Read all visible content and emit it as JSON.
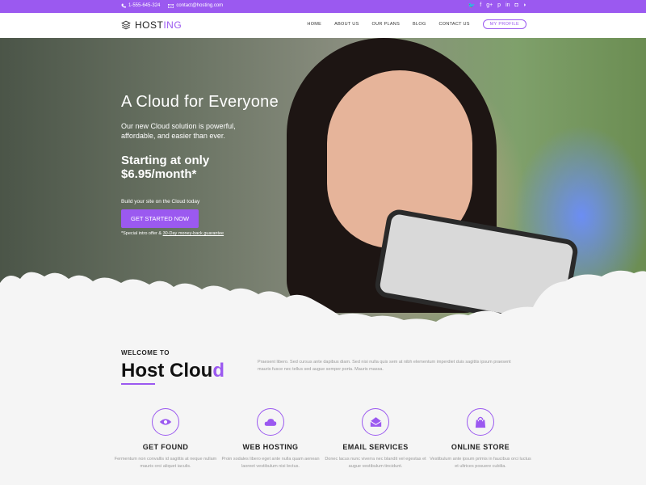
{
  "topbar": {
    "phone": "1-555-645-324",
    "email": "contact@hosting.com",
    "social_icons": [
      "twitter-icon",
      "facebook-icon",
      "google-plus-icon",
      "pinterest-icon",
      "linkedin-icon",
      "instagram-icon",
      "rss-icon"
    ]
  },
  "logo": {
    "text_main": "HOST",
    "text_accent": "ING"
  },
  "nav": {
    "items": [
      "HOME",
      "ABOUT US",
      "OUR PLANS",
      "BLOG",
      "CONTACT US"
    ],
    "profile": "MY PROFILE"
  },
  "hero": {
    "title": "A Cloud for Everyone",
    "subtitle": "Our new Cloud solution is powerful, affordable, and easier than ever.",
    "price_line1": "Starting at only",
    "price_line2": "$6.95/month*",
    "build_text": "Build your site on the Cloud today",
    "cta": "GET STARTED NOW",
    "note_prefix": "*Special intro offer & ",
    "note_link": "30-Day money-back guarantee"
  },
  "welcome": {
    "kicker": "WELCOME TO",
    "title_main": "Host Clou",
    "title_accent": "d",
    "text": "Praesent libero. Sed cursus ante dapibus diam. Sed nisi nulla quis sem at nibh elementum imperdiet duis sagittis ipsum praesent mauris fusce nec tellus sed augue semper porta. Mauris massa."
  },
  "features": [
    {
      "icon": "eye-icon",
      "title": "GET FOUND",
      "desc": "Fermentum non convallis id sagittis at neque nullam mauris orci aliquet iaculis."
    },
    {
      "icon": "cloud-icon",
      "title": "WEB HOSTING",
      "desc": "Proin sodales libero eget ante nulla quam aenean laoreet vestibulum nisi lectus."
    },
    {
      "icon": "envelope-icon",
      "title": "EMAIL SERVICES",
      "desc": "Donec lacus nunc viverra nec blandit vel egestas et augue vestibulum tincidunt."
    },
    {
      "icon": "shopping-bag-icon",
      "title": "ONLINE STORE",
      "desc": "Vestibulum ante ipsum primis in faucibus orci luctus et ultrices posuere cubilia."
    }
  ],
  "colors": {
    "accent": "#9b59f0",
    "background": "#f5f5f5",
    "muted_text": "#999999"
  }
}
